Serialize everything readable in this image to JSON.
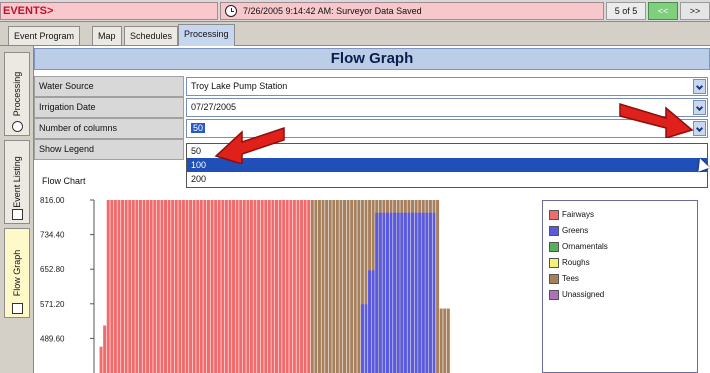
{
  "topbar": {
    "events_label": "EVENTS>",
    "status_text": "7/26/2005 9:14:42 AM: Surveyor Data Saved",
    "pager": "5 of 5",
    "prev_label": "<<",
    "next_label": ">>"
  },
  "tabs": [
    {
      "label": "Event Program",
      "active": false
    },
    {
      "label": "Map",
      "active": false
    },
    {
      "label": "Schedules",
      "active": false
    },
    {
      "label": "Processing",
      "active": true
    }
  ],
  "side_tabs": [
    {
      "label": "Processing",
      "icon": "gear-icon",
      "active": false
    },
    {
      "label": "Event Listing",
      "icon": "list-icon",
      "active": false
    },
    {
      "label": "Flow Graph",
      "icon": "graph-icon",
      "active": true
    }
  ],
  "header_title": "Flow Graph",
  "form": {
    "water_source": {
      "label": "Water Source",
      "value": "Troy Lake Pump Station"
    },
    "irrigation_date": {
      "label": "Irrigation Date",
      "value": "07/27/2005"
    },
    "num_columns": {
      "label": "Number of columns",
      "value": "50"
    },
    "show_legend": {
      "label": "Show Legend"
    }
  },
  "dropdown_options": [
    "50",
    "100",
    "200"
  ],
  "dropdown_highlighted": "100",
  "chart_data": {
    "type": "bar",
    "title": "Flow Chart",
    "y_ticks": [
      "816.00",
      "734.40",
      "652.80",
      "571.20",
      "489.60"
    ],
    "legend": [
      {
        "name": "Fairways",
        "color": "#f06b6b"
      },
      {
        "name": "Greens",
        "color": "#5a5ae0"
      },
      {
        "name": "Ornamentals",
        "color": "#58b058"
      },
      {
        "name": "Roughs",
        "color": "#f4f07a"
      },
      {
        "name": "Tees",
        "color": "#a67f5d"
      },
      {
        "name": "Unassigned",
        "color": "#b070c0"
      }
    ],
    "colors": {
      "fairways": "#f06b6b",
      "greens": "#5a5ae0",
      "tees": "#a67f5d"
    },
    "series": [
      {
        "name": "Fairways",
        "values": [
          0,
          470,
          520,
          816,
          816,
          816,
          816,
          816,
          816,
          816,
          816,
          816,
          816,
          816,
          816,
          816,
          816,
          816,
          816,
          816,
          816,
          816,
          816,
          816,
          816,
          816,
          816,
          816,
          816,
          816,
          816,
          816,
          816,
          816,
          816,
          816,
          816,
          816,
          816,
          816,
          816,
          816,
          816,
          816,
          816,
          816,
          816,
          816,
          816,
          816,
          816,
          816,
          816,
          816,
          816,
          816,
          816,
          816,
          816,
          816,
          0,
          0,
          0,
          0,
          0,
          0,
          0,
          0,
          0,
          0,
          0,
          0,
          0,
          0,
          0,
          0,
          0,
          0,
          0,
          0,
          0,
          0,
          0,
          0,
          0,
          0,
          0,
          0,
          0,
          0,
          0,
          0,
          0,
          0,
          0,
          0,
          0,
          0,
          0,
          0
        ]
      },
      {
        "name": "Tees",
        "values": [
          0,
          0,
          0,
          0,
          0,
          0,
          0,
          0,
          0,
          0,
          0,
          0,
          0,
          0,
          0,
          0,
          0,
          0,
          0,
          0,
          0,
          0,
          0,
          0,
          0,
          0,
          0,
          0,
          0,
          0,
          0,
          0,
          0,
          0,
          0,
          0,
          0,
          0,
          0,
          0,
          0,
          0,
          0,
          0,
          0,
          0,
          0,
          0,
          0,
          0,
          0,
          0,
          0,
          0,
          0,
          0,
          0,
          0,
          0,
          0,
          816,
          816,
          816,
          816,
          816,
          816,
          816,
          816,
          816,
          816,
          816,
          816,
          816,
          816,
          816,
          816,
          816,
          816,
          816,
          816,
          816,
          816,
          816,
          816,
          816,
          816,
          816,
          816,
          816,
          816,
          816,
          816,
          816,
          816,
          816,
          816,
          816,
          816,
          816,
          0
        ]
      }
    ]
  }
}
